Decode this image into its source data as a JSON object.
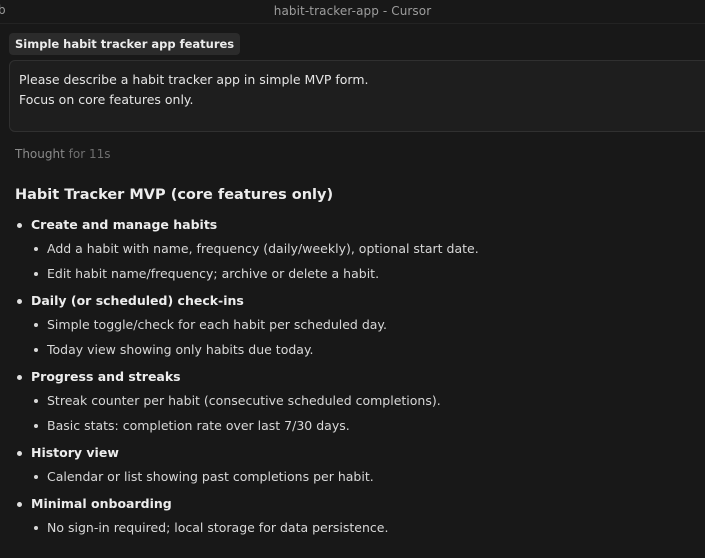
{
  "window": {
    "title": "habit-tracker-app - Cursor",
    "left_glyph": "b"
  },
  "chat": {
    "chip_label": "Simple habit tracker app features",
    "prompt_lines": [
      "Please describe a habit tracker app in simple MVP form.",
      "Focus on core features only."
    ],
    "thought_label": "Thought",
    "thought_duration": "for 11s"
  },
  "response": {
    "heading": "Habit Tracker MVP (core features only)",
    "sections": [
      {
        "label": "Create and manage habits",
        "items": [
          "Add a habit with name, frequency (daily/weekly), optional start date.",
          "Edit habit name/frequency; archive or delete a habit."
        ]
      },
      {
        "label": "Daily (or scheduled) check-ins",
        "items": [
          "Simple toggle/check for each habit per scheduled day.",
          "Today view showing only habits due today."
        ]
      },
      {
        "label": "Progress and streaks",
        "items": [
          "Streak counter per habit (consecutive scheduled completions).",
          "Basic stats: completion rate over last 7/30 days."
        ]
      },
      {
        "label": "History view",
        "items": [
          "Calendar or list showing past completions per habit."
        ]
      },
      {
        "label": "Minimal onboarding",
        "items": [
          "No sign-in required; local storage for data persistence."
        ]
      }
    ]
  }
}
